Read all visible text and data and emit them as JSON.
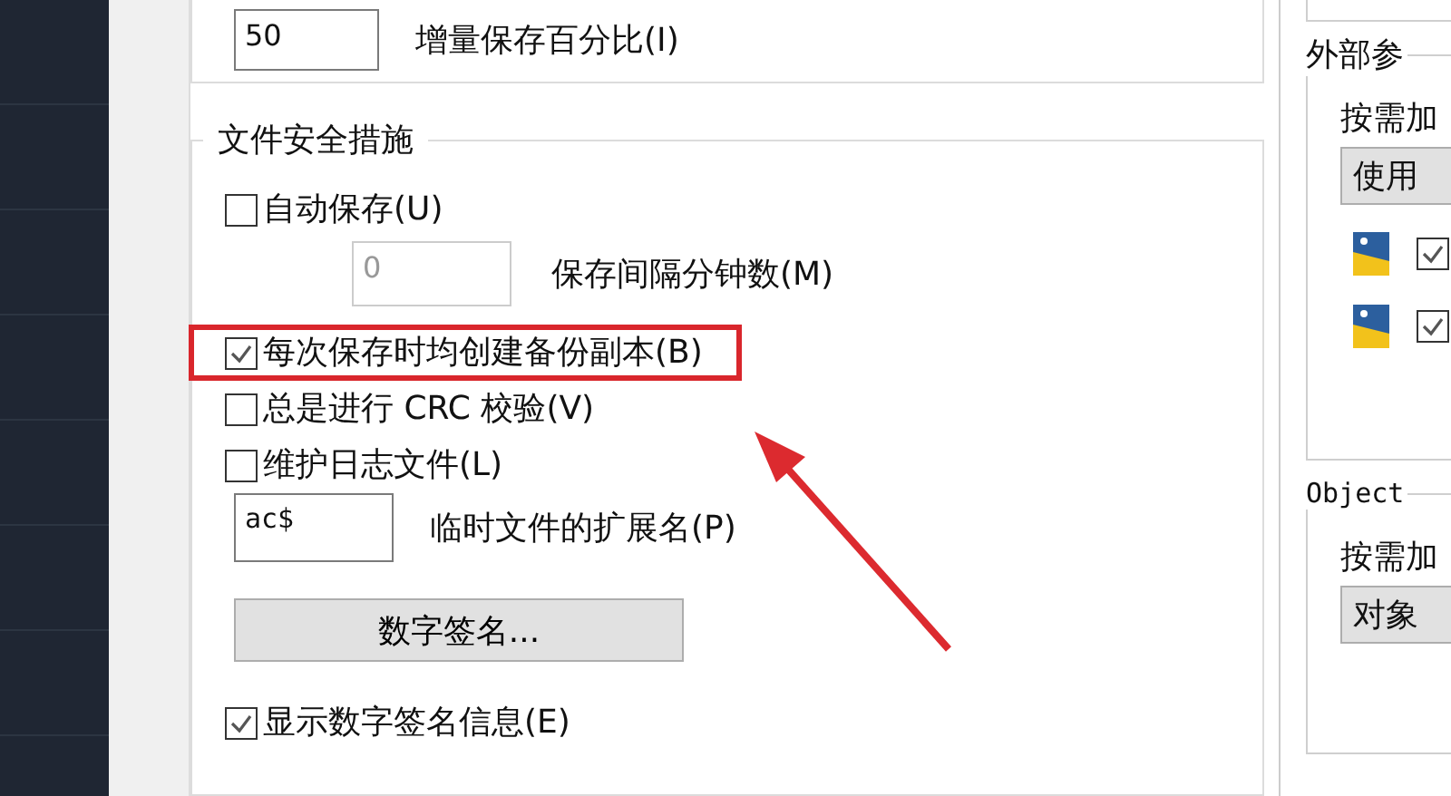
{
  "incremental_save": {
    "value": "50",
    "label": "增量保存百分比(I)"
  },
  "file_safety": {
    "title": "文件安全措施",
    "autosave": {
      "label": "自动保存(U)",
      "checked": false,
      "highlighted": false
    },
    "interval": {
      "value": "0",
      "label": "保存间隔分钟数(M)",
      "disabled": true
    },
    "options": [
      {
        "label": "每次保存时均创建备份副本(B)",
        "checked": true,
        "highlighted": true
      },
      {
        "label": "总是进行 CRC 校验(V)",
        "checked": false,
        "highlighted": false
      },
      {
        "label": "维护日志文件(L)",
        "checked": false,
        "highlighted": false
      }
    ],
    "temp_ext": {
      "value": "ac$",
      "label": "临时文件的扩展名(P)"
    },
    "signature_button": "数字签名...",
    "show_signature": {
      "label": "显示数字签名信息(E)",
      "checked": true,
      "highlighted": false
    }
  },
  "xref": {
    "title": "外部参",
    "demand_label": "按需加",
    "dropdown": "使用",
    "rows": [
      {
        "checked": true
      },
      {
        "checked": true
      }
    ]
  },
  "objectarx": {
    "title": "Object",
    "demand_label": "按需加",
    "dropdown": "对象"
  }
}
